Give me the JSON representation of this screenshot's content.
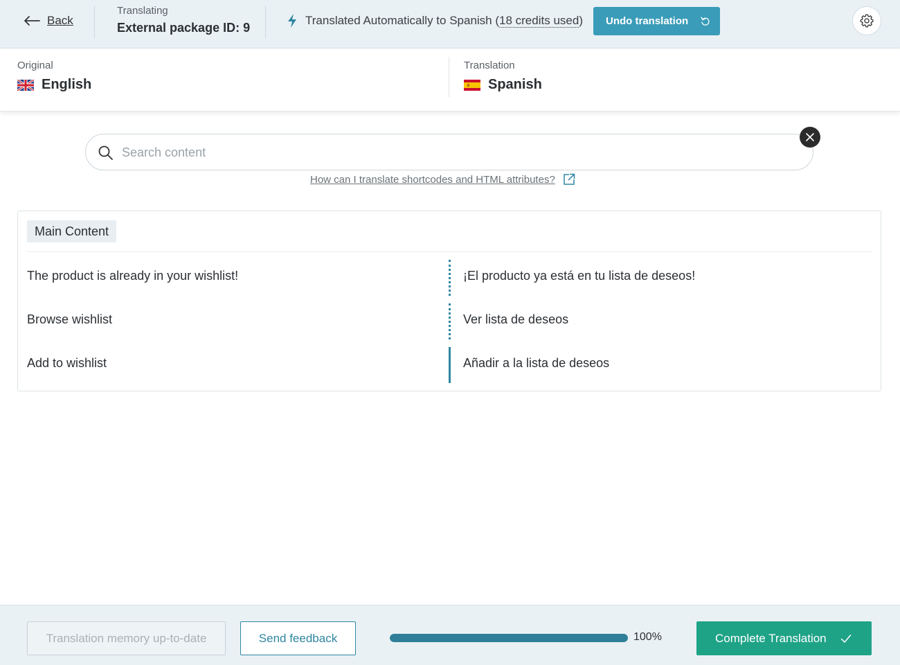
{
  "header": {
    "back_label": "Back",
    "context_caption": "Translating",
    "context_title": "External package ID: 9",
    "auto_text": "Translated Automatically to Spanish (",
    "credits_text": "18 credits used",
    "auto_close": ")",
    "undo_label": "Undo translation",
    "icons": [
      "back-arrow-icon",
      "lightning-icon",
      "undo-icon",
      "gear-icon"
    ]
  },
  "languages": {
    "original_caption": "Original",
    "original_name": "English",
    "translation_caption": "Translation",
    "translation_name": "Spanish"
  },
  "search": {
    "placeholder": "Search content",
    "help_link": "How can I translate shortcodes and HTML attributes?"
  },
  "section": {
    "title": "Main Content",
    "segments": [
      {
        "original": "The product is already in your wishlist!",
        "translation": "¡El producto ya está en tu lista de deseos!",
        "status": "automatic"
      },
      {
        "original": "Browse wishlist",
        "translation": "Ver lista de deseos",
        "status": "automatic"
      },
      {
        "original": "Add to wishlist",
        "translation": "Añadir a la lista de deseos",
        "status": "complete"
      }
    ]
  },
  "footer": {
    "memory_label": "Translation memory up-to-date",
    "feedback_label": "Send feedback",
    "progress": 1.0,
    "progress_label": "100%",
    "complete_label": "Complete Translation"
  },
  "colors": {
    "accent": "#3a9cb8",
    "primary_dark": "#2e86a1",
    "complete_green": "#1fa387",
    "bar_bg": "#e9f1f5"
  }
}
